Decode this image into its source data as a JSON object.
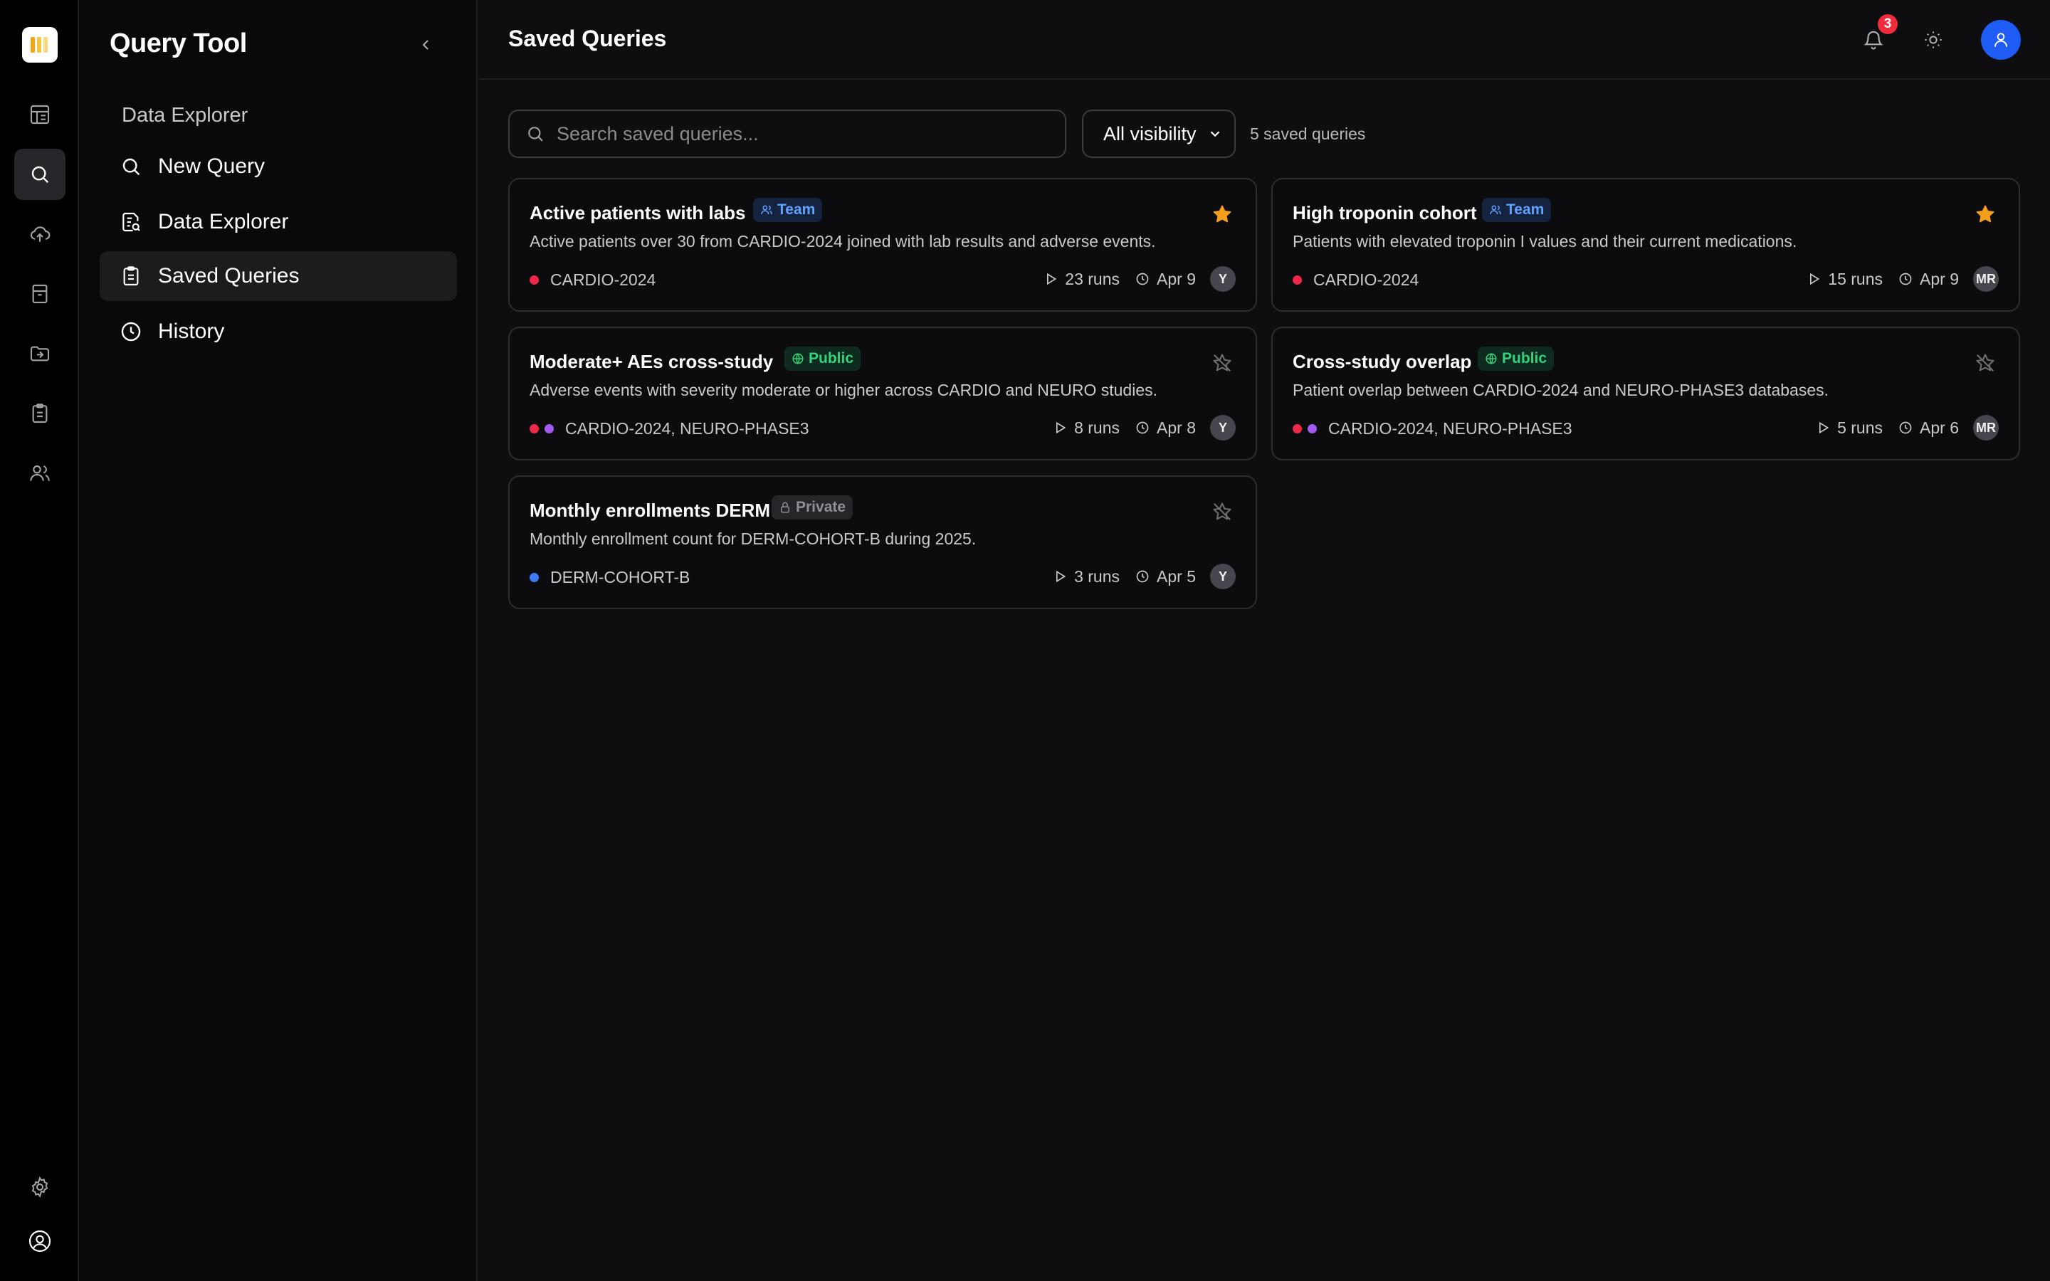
{
  "app": {
    "title": "Query Tool",
    "section_label": "Data Explorer"
  },
  "nav": [
    {
      "label": "New Query",
      "icon": "search-icon"
    },
    {
      "label": "Data Explorer",
      "icon": "data-explorer-icon"
    },
    {
      "label": "Saved Queries",
      "icon": "clipboard-icon",
      "active": true
    },
    {
      "label": "History",
      "icon": "clock-icon"
    }
  ],
  "rail": [
    {
      "icon": "dashboard-icon"
    },
    {
      "icon": "search-icon",
      "active": true
    },
    {
      "icon": "upload-cloud-icon"
    },
    {
      "icon": "archive-icon"
    },
    {
      "icon": "folder-import-icon"
    },
    {
      "icon": "clipboard-icon"
    },
    {
      "icon": "users-icon"
    },
    {
      "icon": "settings-icon"
    },
    {
      "icon": "user-icon"
    }
  ],
  "header": {
    "title": "Saved Queries",
    "notification_count": "3"
  },
  "toolbar": {
    "search_placeholder": "Search saved queries...",
    "visibility_selected": "All visibility",
    "count_text": "5 saved queries"
  },
  "colors": {
    "cardio": "#f0284a",
    "neuro": "#a45cf0",
    "derm": "#3c7bf5",
    "star": "#f59e1b",
    "accent": "#1e5cf5"
  },
  "queries": [
    {
      "title": "Active patients with labs",
      "visibility": "Team",
      "starred": true,
      "description": "Active patients over 30 from CARDIO-2024 joined with lab results and adverse events.",
      "databases": "CARDIO-2024",
      "runs": "23 runs",
      "date": "Apr 9",
      "user": "Y"
    },
    {
      "title": "High troponin cohort",
      "visibility": "Team",
      "starred": true,
      "description": "Patients with elevated troponin I values and their current medications.",
      "databases": "CARDIO-2024",
      "runs": "15 runs",
      "date": "Apr 9",
      "user": "MR"
    },
    {
      "title": "Moderate+ AEs cross-study",
      "visibility": "Public",
      "starred": false,
      "description": "Adverse events with severity moderate or higher across CARDIO and NEURO studies.",
      "databases": "CARDIO-2024, NEURO-PHASE3",
      "runs": "8 runs",
      "date": "Apr 8",
      "user": "Y"
    },
    {
      "title": "Cross-study overlap",
      "visibility": "Public",
      "starred": false,
      "description": "Patient overlap between CARDIO-2024 and NEURO-PHASE3 databases.",
      "databases": "CARDIO-2024, NEURO-PHASE3",
      "runs": "5 runs",
      "date": "Apr 6",
      "user": "MR"
    },
    {
      "title": "Monthly enrollments DERM",
      "visibility": "Private",
      "starred": false,
      "description": "Monthly enrollment count for DERM-COHORT-B during 2025.",
      "databases": "DERM-COHORT-B",
      "runs": "3 runs",
      "date": "Apr 5",
      "user": "Y"
    }
  ]
}
